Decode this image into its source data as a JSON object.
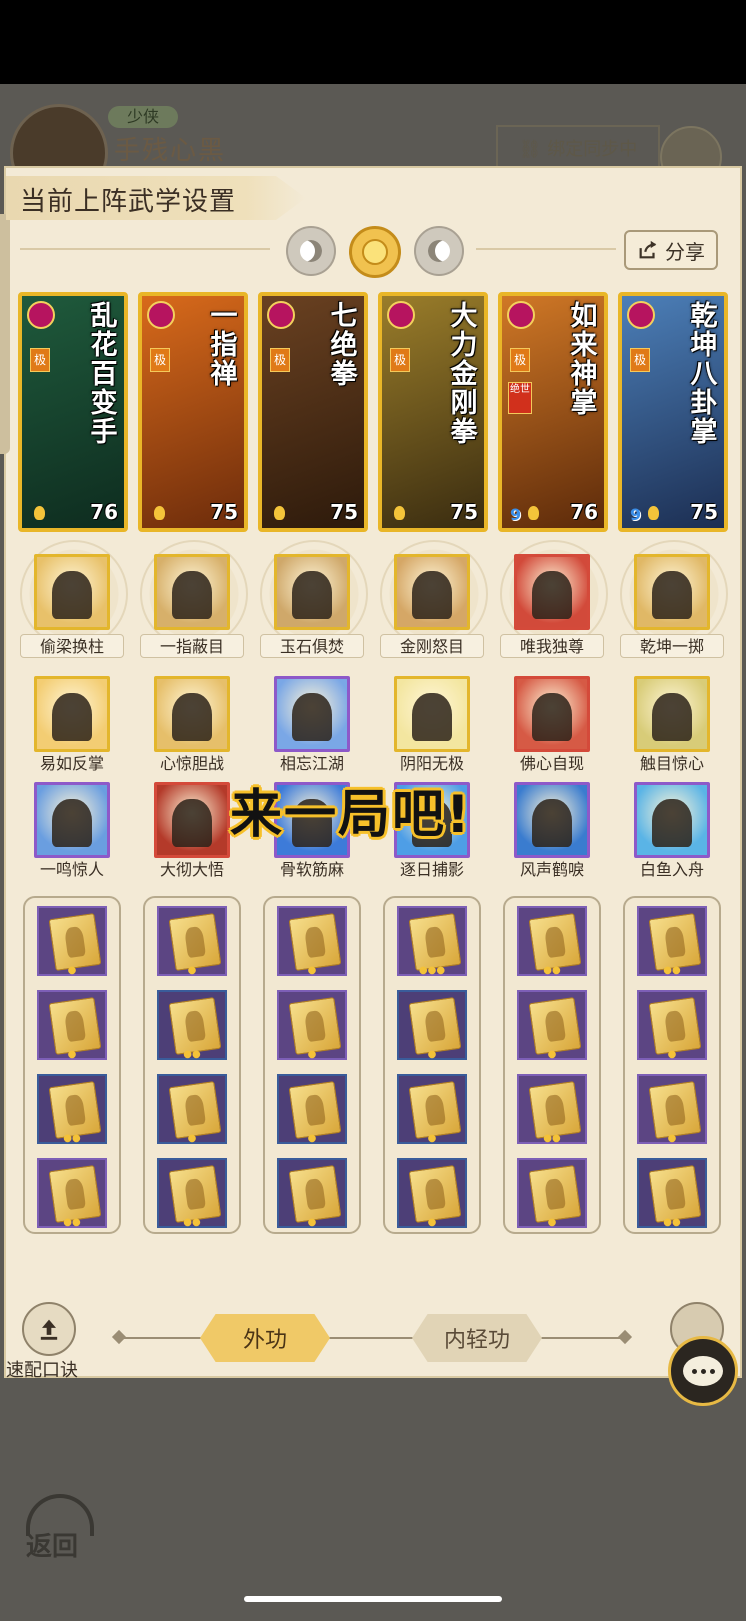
{
  "header": {
    "player_rank": "少侠",
    "player_name": "手残心黑",
    "sync_status": "绑定同步中"
  },
  "panel": {
    "title": "当前上阵武学设置",
    "share_label": "分享",
    "modes": [
      {
        "name": "moon-left",
        "active": false
      },
      {
        "name": "sun",
        "active": true
      },
      {
        "name": "moon-right",
        "active": false
      }
    ]
  },
  "signature_cards": [
    {
      "name": "乱花百变手",
      "level": "76",
      "grade": "极",
      "badge": "",
      "has_nine": false,
      "bg": [
        "#1f5a3c",
        "#0e2c1f"
      ]
    },
    {
      "name": "一指禅",
      "level": "75",
      "grade": "极",
      "badge": "",
      "has_nine": false,
      "bg": [
        "#d86a1b",
        "#6d2c0b"
      ]
    },
    {
      "name": "七绝拳",
      "level": "75",
      "grade": "极",
      "badge": "",
      "has_nine": false,
      "bg": [
        "#6a4121",
        "#2d1a0b"
      ]
    },
    {
      "name": "大力金刚拳",
      "level": "75",
      "grade": "极",
      "badge": "",
      "has_nine": false,
      "bg": [
        "#9a7d2a",
        "#3a2c10"
      ]
    },
    {
      "name": "如来神掌",
      "level": "76",
      "grade": "极",
      "badge": "绝世",
      "has_nine": true,
      "bg": [
        "#d07826",
        "#5c2a0a"
      ]
    },
    {
      "name": "乾坤八卦掌",
      "level": "75",
      "grade": "极",
      "badge": "",
      "has_nine": true,
      "bg": [
        "#4c7fb8",
        "#1c2e52"
      ]
    }
  ],
  "skills_row1": [
    "偷梁换柱",
    "一指蔽目",
    "玉石俱焚",
    "金刚怒目",
    "唯我独尊",
    "乾坤一掷"
  ],
  "skills_row2": [
    "易如反掌",
    "心惊胆战",
    "相忘江湖",
    "阴阳无极",
    "佛心自现",
    "触目惊心"
  ],
  "skills_row3": [
    "一鸣惊人",
    "大彻大悟",
    "骨软筋麻",
    "逐日捕影",
    "风声鹤唳",
    "白鱼入舟"
  ],
  "overlay_text": "来一局吧!",
  "bottom": {
    "quick_label": "速配口诀",
    "tab_outer": "外功",
    "tab_inner": "内轻功"
  },
  "back_label": "返回",
  "colors": {
    "panel_bg": "#f3ead6",
    "card_border_gold": "#e9b628",
    "accent_orange": "#f0c967",
    "overlay_stroke": "#f6c02a"
  }
}
